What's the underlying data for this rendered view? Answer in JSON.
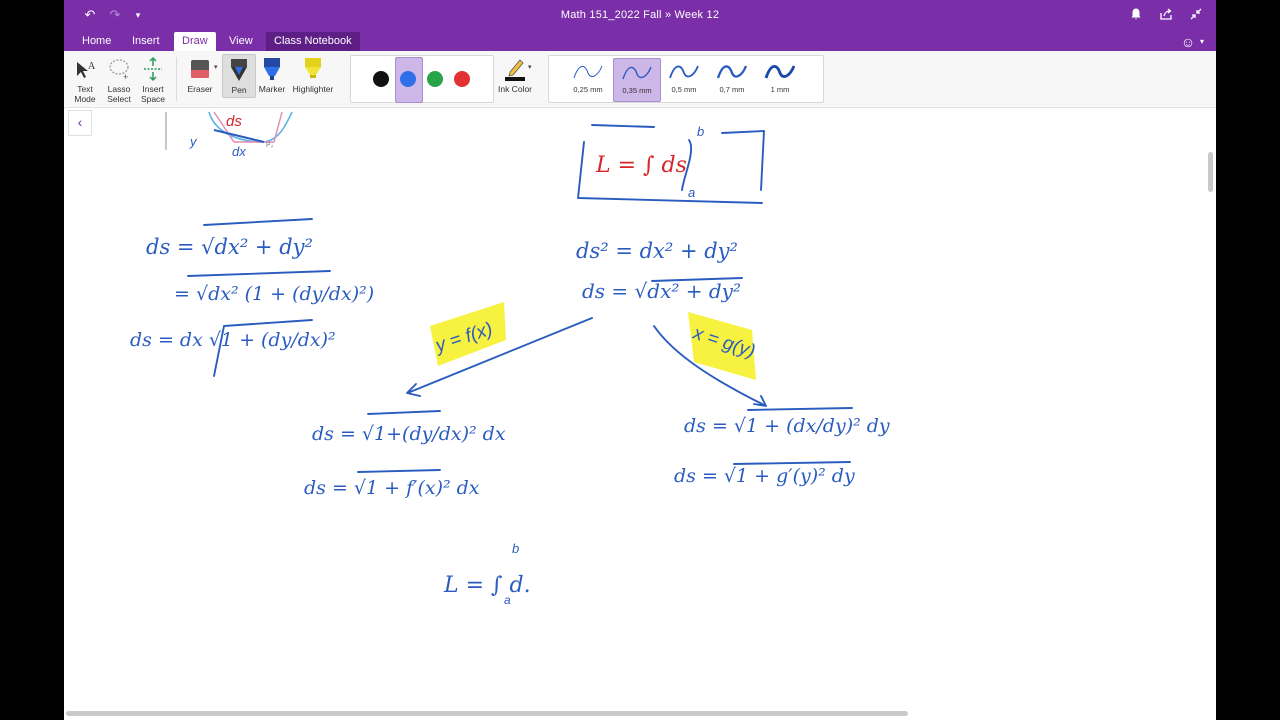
{
  "window": {
    "title": "Math 151_2022 Fall  »  Week 12"
  },
  "tabs": [
    {
      "label": "Home"
    },
    {
      "label": "Insert"
    },
    {
      "label": "Draw"
    },
    {
      "label": "View"
    },
    {
      "label": "Class Notebook"
    }
  ],
  "ribbon": {
    "text_mode": [
      "Text",
      "Mode"
    ],
    "lasso_select": [
      "Lasso",
      "Select"
    ],
    "insert_space": [
      "Insert",
      "Space"
    ],
    "eraser": "Eraser",
    "pen": "Pen",
    "marker": "Marker",
    "highlighter": "Highlighter",
    "colors": [
      "#111111",
      "#2f6fe8",
      "#27a34a",
      "#e23232"
    ],
    "selected_color_index": 1,
    "ink_color": "Ink Color",
    "thicknesses": [
      "0,25 mm",
      "0,35 mm",
      "0,5 mm",
      "0,7 mm",
      "1 mm"
    ],
    "selected_thickness_index": 1
  },
  "theme": {
    "brand": "#7a2ea8",
    "ink_blue": "#2a5cc0",
    "ink_red": "#d6262a",
    "highlight_yellow": "#f6f02a"
  },
  "notes": {
    "fig_ds": "ds",
    "fig_dx": "dx",
    "fig_p2": "P₂",
    "fig_y": "y",
    "box_formula": "L =  ∫  ds",
    "box_upper": "b",
    "box_lower": "a",
    "left_1": "ds = √dx² + dy²",
    "left_2": "= √dx² (1 + (dy/dx)²)",
    "left_3": "ds = dx √1 + (dy/dx)²",
    "center_1": "ds² = dx² + dy²",
    "center_2": "ds = √dx² + dy²",
    "hl_left": "y = f(x)",
    "hl_right": "x = g(y)",
    "mid_left_1": "ds = √1+(dy/dx)² dx",
    "mid_left_2": "ds = √1 + f′(x)² dx",
    "mid_right_1": "ds = √1 + (dx/dy)² dy",
    "mid_right_2": "ds = √1 + g′(y)² dy",
    "bottom": "L = ∫ d.",
    "bottom_upper": "b",
    "bottom_lower": "a"
  }
}
